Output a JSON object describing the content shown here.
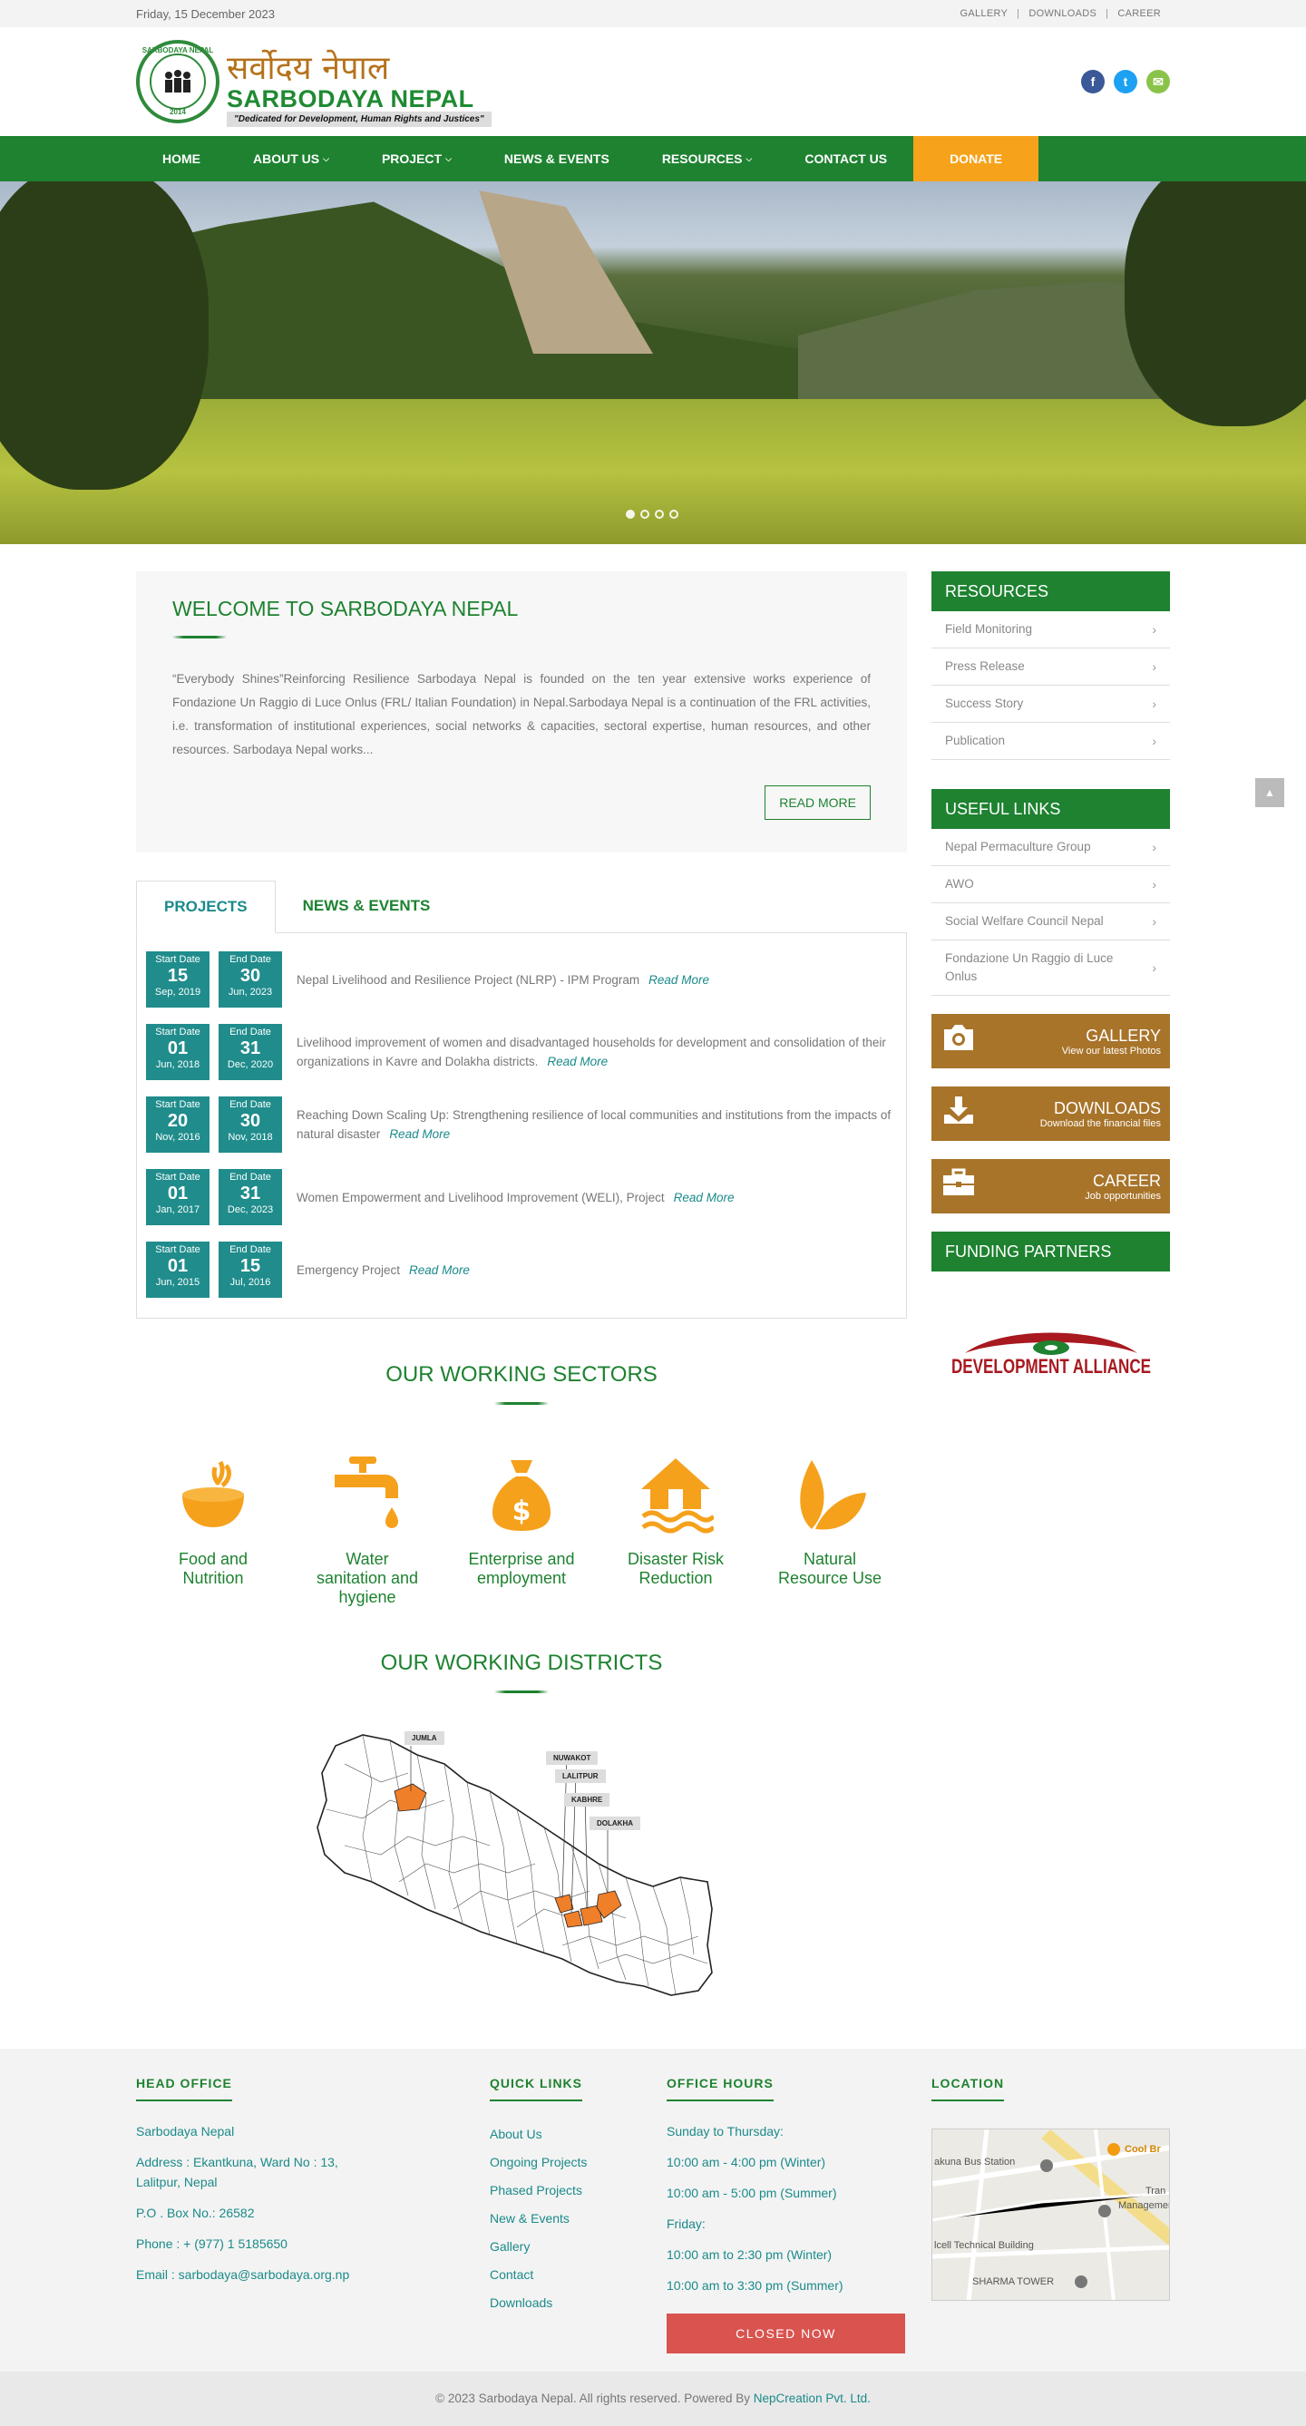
{
  "topbar": {
    "date": "Friday, 15 December 2023",
    "links": [
      "GALLERY",
      "DOWNLOADS",
      "CAREER"
    ]
  },
  "header": {
    "seal_arc": "SARBODAYA NEPAL",
    "seal_year": "2014",
    "name_nepali": "सर्वोदय नेपाल",
    "name_english": "SARBODAYA NEPAL",
    "tagline": "\"Dedicated for Development, Human Rights and Justices\"",
    "social": [
      {
        "name": "facebook",
        "glyph": "f",
        "color": "#3b5998"
      },
      {
        "name": "twitter",
        "glyph": "t",
        "color": "#1da1f2"
      },
      {
        "name": "email",
        "glyph": "✉",
        "color": "#8bc34a"
      }
    ]
  },
  "nav": {
    "items": [
      "HOME",
      "ABOUT US",
      "PROJECT",
      "NEWS & EVENTS",
      "RESOURCES",
      "CONTACT US"
    ],
    "donate": "DONATE",
    "accent": "#1e8230",
    "donate_color": "#f7a21b"
  },
  "hero": {
    "slides": 4,
    "active_slide": 1
  },
  "welcome": {
    "title": "WELCOME TO SARBODAYA NEPAL",
    "text": "“Everybody Shines”Reinforcing Resilience Sarbodaya Nepal is founded on the ten year extensive works experience of Fondazione Un Raggio di Luce Onlus (FRL/ Italian Foundation) in Nepal.Sarbodaya Nepal is a continuation of the FRL activities, i.e. transformation of institutional experiences, social networks & capacities, sectoral expertise, human resources, and other resources. Sarbodaya Nepal works...",
    "read_more": "READ MORE"
  },
  "tabs": [
    "PROJECTS",
    "NEWS & EVENTS"
  ],
  "projects": {
    "start_label": "Start Date",
    "end_label": "End Date",
    "read_more": "Read More",
    "items": [
      {
        "start_day": "15",
        "start_my": "Sep, 2019",
        "end_day": "30",
        "end_my": "Jun, 2023",
        "title": "Nepal Livelihood and Resilience Project (NLRP) - IPM Program"
      },
      {
        "start_day": "01",
        "start_my": "Jun, 2018",
        "end_day": "31",
        "end_my": "Dec, 2020",
        "title": "Livelihood improvement of women and disadvantaged households for development and consolidation of their organizations in Kavre and Dolakha districts."
      },
      {
        "start_day": "20",
        "start_my": "Nov, 2016",
        "end_day": "30",
        "end_my": "Nov, 2018",
        "title": "Reaching Down Scaling Up: Strengthening resilience of local communities and institutions from the impacts of natural disaster"
      },
      {
        "start_day": "01",
        "start_my": "Jan, 2017",
        "end_day": "31",
        "end_my": "Dec, 2023",
        "title": "Women Empowerment and Livelihood Improvement (WELI), Project"
      },
      {
        "start_day": "01",
        "start_my": "Jun, 2015",
        "end_day": "15",
        "end_my": "Jul, 2016",
        "title": "Emergency Project"
      }
    ]
  },
  "sidebar": {
    "resources_title": "RESOURCES",
    "resources": [
      "Field Monitoring",
      "Press Release",
      "Success Story",
      "Publication"
    ],
    "useful_title": "USEFUL LINKS",
    "useful": [
      "Nepal Permaculture Group",
      "AWO",
      "Social Welfare Council Nepal",
      "Fondazione Un Raggio di Luce Onlus"
    ],
    "banners": [
      {
        "icon": "camera-icon",
        "title": "GALLERY",
        "sub": "View our latest Photos"
      },
      {
        "icon": "download-icon",
        "title": "DOWNLOADS",
        "sub": "Download the financial files"
      },
      {
        "icon": "briefcase-icon",
        "title": "CAREER",
        "sub": "Job opportunities"
      }
    ],
    "funding_title": "FUNDING PARTNERS",
    "partner_name": "DEVELOPMENT ALLIANCE"
  },
  "sectors": {
    "title": "OUR WORKING SECTORS",
    "items": [
      "Food and Nutrition",
      "Water sanitation and hygiene",
      "Enterprise and employment",
      "Disaster Risk Reduction",
      "Natural Resource Use"
    ]
  },
  "districts": {
    "title": "OUR WORKING DISTRICTS",
    "tags": [
      "JUMLA",
      "NUWAKOT",
      "LALITPUR",
      "KABHRE",
      "DOLAKHA"
    ]
  },
  "footer": {
    "head_office_title": "HEAD OFFICE",
    "org": "Sarbodaya Nepal",
    "address": "Address : Ekantkuna, Ward No : 13, Lalitpur, Nepal",
    "pobox": "P.O . Box No.: 26582",
    "phone": "Phone : + (977) 1 5185650",
    "email": "Email : sarbodaya@sarbodaya.org.np",
    "quick_title": "QUICK LINKS",
    "quick": [
      "About Us",
      "Ongoing Projects",
      "Phased Projects",
      "New & Events",
      "Gallery",
      "Contact",
      "Downloads"
    ],
    "hours_title": "OFFICE HOURS",
    "hours": [
      "Sunday to Thursday:",
      "10:00 am - 4:00 pm (Winter)",
      "10:00 am - 5:00 pm (Summer)",
      "Friday:",
      "10:00 am to 2:30 pm (Winter)",
      "10:00 am to 3:30 pm (Summer)"
    ],
    "closed": "CLOSED NOW",
    "location_title": "LOCATION",
    "map_labels": [
      "akuna Bus Station",
      "Cool Br",
      "Management",
      "Tran",
      "lcell Technical Building",
      "SHARMA TOWER"
    ],
    "copyright": "© 2023 Sarbodaya Nepal. All rights reserved. Powered By",
    "powered": "NepCreation Pvt. Ltd."
  }
}
